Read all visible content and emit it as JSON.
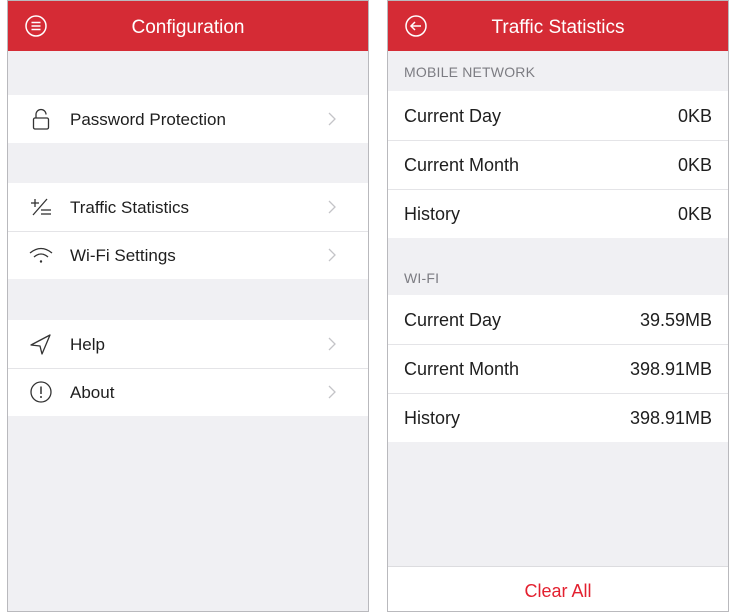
{
  "colors": {
    "accent": "#d52b35",
    "clear_text": "#e3202f",
    "background": "#f0f0f3"
  },
  "config_screen": {
    "title": "Configuration",
    "menu_icon": "menu-circle-icon",
    "groups": [
      {
        "items": [
          {
            "label": "Password Protection",
            "icon": "lock-icon"
          }
        ]
      },
      {
        "items": [
          {
            "label": "Traffic Statistics",
            "icon": "plus-minus-icon"
          },
          {
            "label": "Wi-Fi Settings",
            "icon": "wifi-icon"
          }
        ]
      },
      {
        "items": [
          {
            "label": "Help",
            "icon": "send-icon"
          },
          {
            "label": "About",
            "icon": "info-circle-icon"
          }
        ]
      }
    ]
  },
  "traffic_screen": {
    "title": "Traffic Statistics",
    "back_icon": "back-arrow-icon",
    "sections": [
      {
        "header": "MOBILE NETWORK",
        "rows": [
          {
            "label": "Current Day",
            "value": "0KB"
          },
          {
            "label": "Current Month",
            "value": "0KB"
          },
          {
            "label": "History",
            "value": "0KB"
          }
        ]
      },
      {
        "header": "WI-FI",
        "rows": [
          {
            "label": "Current Day",
            "value": "39.59MB"
          },
          {
            "label": "Current Month",
            "value": "398.91MB"
          },
          {
            "label": "History",
            "value": "398.91MB"
          }
        ]
      }
    ],
    "clear_button": "Clear All"
  }
}
